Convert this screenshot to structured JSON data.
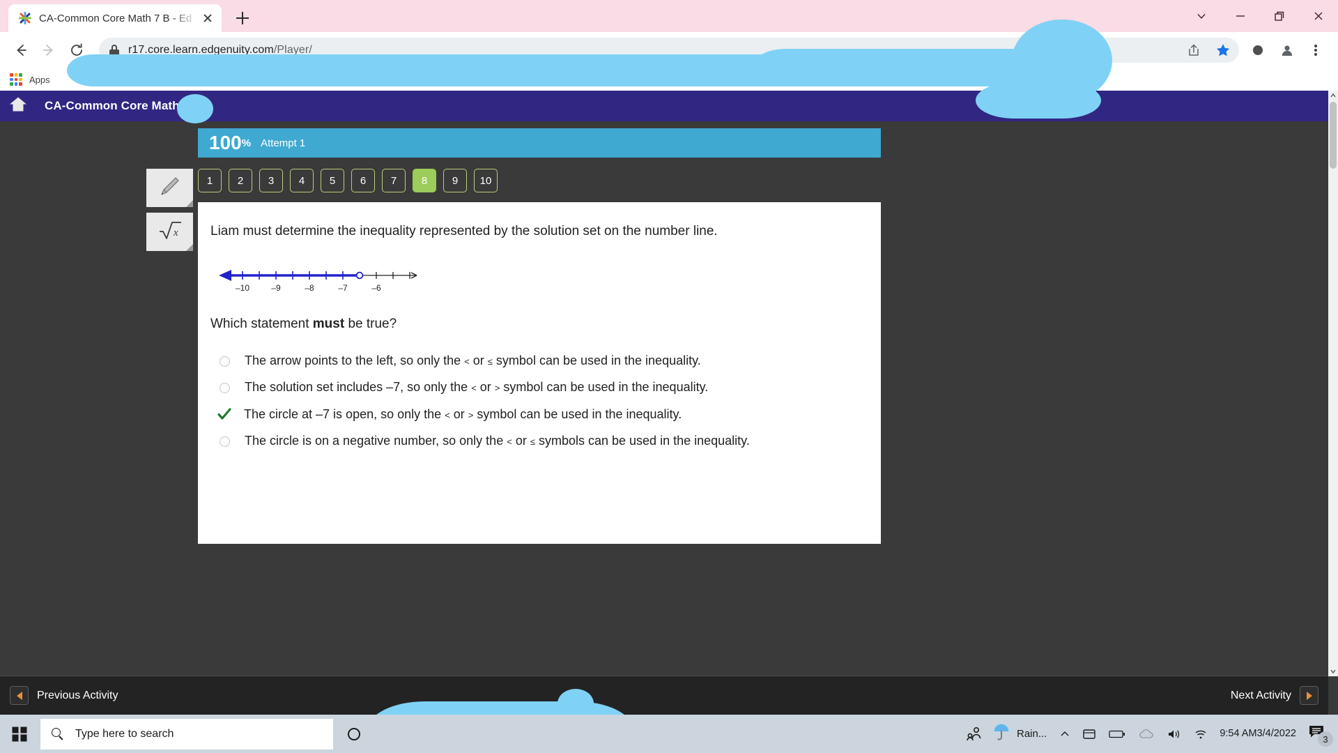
{
  "browser": {
    "tab": {
      "title": "CA-Common Core Math 7 B - Ed",
      "favicon_name": "edgenuity-logo-icon",
      "close_name": "close-tab-icon"
    },
    "new_tab_label": "+",
    "url_protocol_host": "r17.core.learn.edgenuity.com",
    "url_path": "/Player/",
    "bookmarks": {
      "apps_label": "Apps"
    },
    "window_controls": [
      "chevron-down",
      "minimize",
      "restore",
      "close"
    ]
  },
  "app": {
    "title": "CA-Common Core Math",
    "home_icon": "home-icon",
    "score": {
      "percent": "100",
      "symbol": "%",
      "attempt": "Attempt 1"
    },
    "question_nav": [
      {
        "label": "1",
        "active": false
      },
      {
        "label": "2",
        "active": false
      },
      {
        "label": "3",
        "active": false
      },
      {
        "label": "4",
        "active": false
      },
      {
        "label": "5",
        "active": false
      },
      {
        "label": "6",
        "active": false
      },
      {
        "label": "7",
        "active": false
      },
      {
        "label": "8",
        "active": true
      },
      {
        "label": "9",
        "active": false
      },
      {
        "label": "10",
        "active": false
      }
    ],
    "tools": [
      {
        "name": "highlighter-tool",
        "icon": "pencil-icon"
      },
      {
        "name": "calculator-tool",
        "icon": "sqrt-x-icon"
      }
    ],
    "question": {
      "stem": "Liam must determine the inequality represented by the solution set on the number line.",
      "prompt_pre": "Which statement ",
      "prompt_bold": "must",
      "prompt_post": " be true?"
    },
    "number_line": {
      "labels": [
        "–10",
        "–9",
        "–8",
        "–7",
        "–6"
      ],
      "shaded_direction": "left",
      "endpoint_value": "–7",
      "endpoint_type": "open-circle",
      "shade_color": "#2222cc",
      "axis_color": "#222222"
    },
    "options": [
      {
        "state": "unselected",
        "pre": "The arrow points to the left, so only the ",
        "sym1": "<",
        "mid": " or ",
        "sym2": "≤",
        "post": " symbol can be used in the inequality."
      },
      {
        "state": "unselected",
        "pre": "The solution set includes –7, so only the ",
        "sym1": "<",
        "mid": " or ",
        "sym2": ">",
        "post": " symbol can be used in the inequality."
      },
      {
        "state": "correct",
        "pre": "The circle at –7 is open, so only the ",
        "sym1": "<",
        "mid": " or ",
        "sym2": ">",
        "post": " symbol can be used in the inequality."
      },
      {
        "state": "unselected",
        "pre": "The circle is on a negative number, so only the ",
        "sym1": "<",
        "mid": " or ",
        "sym2": "≤",
        "post": " symbols can be used in the inequality."
      }
    ],
    "footer": {
      "previous_label": "Previous Activity",
      "next_label": "Next Activity"
    },
    "colors": {
      "header_purple": "#312783",
      "score_blue": "#3fa9d1",
      "active_green": "#9ccc5a",
      "arrow_orange": "#e8913a"
    }
  },
  "taskbar": {
    "search_placeholder": "Type here to search",
    "weather_label": "Rain...",
    "clock_time": "9:54 AM",
    "clock_date": "3/4/2022",
    "notification_count": "3"
  }
}
